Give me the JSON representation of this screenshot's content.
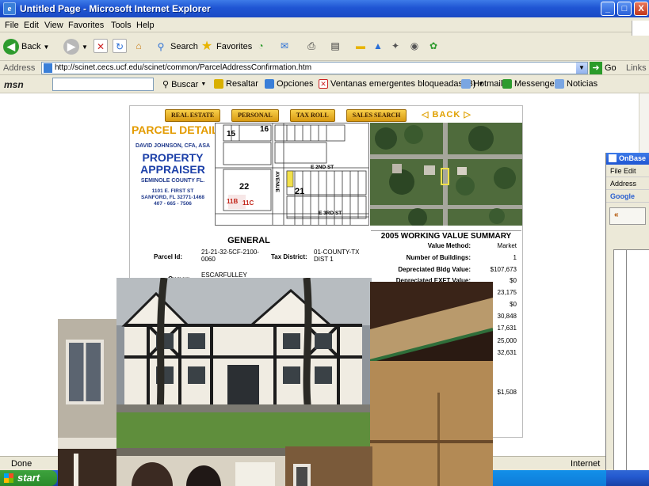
{
  "window": {
    "title": "Untitled Page - Microsoft Internet Explorer",
    "controls": [
      "_",
      "□",
      "X"
    ]
  },
  "menu": [
    "File",
    "Edit",
    "View",
    "Favorites",
    "Tools",
    "Help"
  ],
  "toolbar": {
    "back": "Back",
    "search": "Search",
    "favorites": "Favorites"
  },
  "address": {
    "label": "Address",
    "url": "http://scinet.cecs.ucf.edu/scinet/common/ParcelAddressConfirmation.htm",
    "go": "Go",
    "links": "Links"
  },
  "msnbar": {
    "logo": "msn",
    "buscar": "Buscar",
    "resaltar": "Resaltar",
    "opciones": "Opciones",
    "popups": "Ventanas emergentes bloqueadas (3)",
    "hotmail": "Hotmail",
    "messenger": "Messenger",
    "noticias": "Noticias"
  },
  "page": {
    "nav": [
      "REAL ESTATE",
      "PERSONAL",
      "TAX ROLL",
      "SALES SEARCH"
    ],
    "back": "◁ BACK ▷",
    "parcel_detail": "PARCEL DETAIL",
    "person": "DAVID JOHNSON, CFA, ASA",
    "property": "PROPERTY",
    "appraiser": "APPRAISER",
    "county": "SEMINOLE COUNTY FL.",
    "addr1": "1101 E. FIRST ST",
    "addr2": "SANFORD, FL 32771-1468",
    "phone": "407 - 665 - 7506",
    "plat_labels": {
      "lot15": "15",
      "lot16": "16",
      "lot22": "22",
      "lot21": "21",
      "street1": "E 2ND ST",
      "street2": "E 3RD ST",
      "avenue": "AVENUE",
      "lot11b": "11B",
      "lot11c": "11C"
    },
    "general": {
      "heading": "GENERAL",
      "parcel_id_label": "Parcel Id:",
      "parcel_id": "21-21-32-5CF-2100-0060",
      "tax_district_label": "Tax District:",
      "tax_district": "01-COUNTY-TX DIST 1",
      "owner_label": "Owner:",
      "owner": "ESCARFULLEY"
    },
    "summary": {
      "heading": "2005  WORKING VALUE SUMMARY",
      "rows": [
        {
          "label": "Value Method:",
          "value": "Market"
        },
        {
          "label": "Number of Buildings:",
          "value": "1"
        },
        {
          "label": "Depreciated Bldg Value:",
          "value": "$107,673"
        },
        {
          "label": "Depreciated EXFT Value:",
          "value": "$0"
        }
      ],
      "partial_values": [
        "23,175",
        "$0",
        "30,848",
        "17,631",
        "25,000",
        "32,631"
      ],
      "bottom_value": "$1,508"
    }
  },
  "onbase": {
    "title": "OnBase",
    "menu": "File  Edit",
    "address": "Address",
    "google": "Google"
  },
  "status": {
    "done": "Done",
    "zone": "Internet"
  },
  "taskbar": {
    "start": "start"
  }
}
